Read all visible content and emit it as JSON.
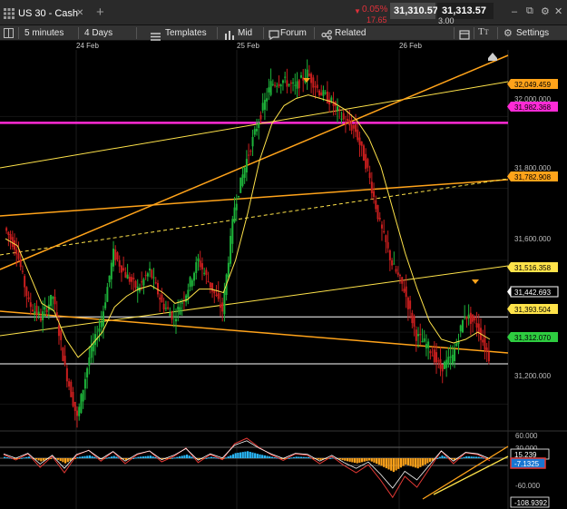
{
  "tab": {
    "title": "US 30 - Cash",
    "close": "✕",
    "add": "+"
  },
  "quote": {
    "change_pct": "0.05%",
    "change_pts": "17.65",
    "bid": "31,310.57",
    "ask": "31,313.57",
    "spread": "3.00",
    "colors": {
      "down": "#e0303a",
      "bid_bg": "#4a4a4a",
      "ask_bg": "#1e1e1e"
    }
  },
  "window": {
    "minimize": "–",
    "restore": "⧉",
    "settings": "⚙",
    "close": "✕"
  },
  "toolbar": {
    "interval": "5 minutes",
    "range": "4 Days",
    "templates": "Templates",
    "mid": "Mid",
    "forum": "Forum",
    "related": "Related",
    "settings": "Settings"
  },
  "dates": [
    "24 Feb",
    "25 Feb",
    "26 Feb"
  ],
  "colors": {
    "magenta": "#ff2bd6",
    "yellow": "#ffe34a",
    "orange": "#ffa31a",
    "white": "#ffffff",
    "cyan": "#29b6f6",
    "red": "#e53935"
  },
  "price_axis": {
    "ticks": [
      "32,000.000",
      "31,800.000",
      "31,600.000",
      "31,200.000"
    ],
    "labels": [
      {
        "text": "32,049.459",
        "style": "orange"
      },
      {
        "text": "31,982.368",
        "style": "magenta"
      },
      {
        "text": "31,782.908",
        "style": "orange"
      },
      {
        "text": "31,516.358",
        "style": "yellow"
      },
      {
        "text": "31,442.693",
        "style": "white"
      },
      {
        "text": "31,393.504",
        "style": "yellow"
      },
      {
        "text": "31,312.070",
        "style": "green"
      }
    ]
  },
  "osc_axis": {
    "ticks": [
      "60.000",
      "30.000",
      "-60.000"
    ],
    "labels": [
      {
        "text": "15.239",
        "style": "white"
      },
      {
        "text": "-7.1325",
        "style": "cyan"
      },
      {
        "text": "-108.9392",
        "style": "white"
      }
    ]
  },
  "chart_data": {
    "type": "line",
    "title": "US 30 - Cash",
    "interval": "5 minutes",
    "range": "4 Days",
    "ylim": [
      31100,
      32180
    ],
    "x": [
      "24 Feb",
      "25 Feb",
      "26 Feb"
    ],
    "series": [
      {
        "values": [
          31690,
          31630,
          31480,
          31440,
          31500,
          31300,
          31160,
          31330,
          31430,
          31620,
          31560,
          31520,
          31570,
          31480,
          31440,
          31510,
          31600,
          31530,
          31460,
          31750,
          31880,
          31990,
          32090,
          32100,
          32080,
          32120,
          32070,
          32040,
          31990,
          31960,
          31850,
          31700,
          31590,
          31520,
          31390,
          31360,
          31300,
          31330,
          31450,
          31420,
          31330
        ]
      },
      {
        "values": [
          31660,
          31640,
          31560,
          31480,
          31460,
          31380,
          31330,
          31360,
          31400,
          31470,
          31500,
          31520,
          31530,
          31510,
          31480,
          31490,
          31520,
          31520,
          31510,
          31600,
          31730,
          31880,
          31980,
          32030,
          32050,
          32060,
          32050,
          32040,
          32020,
          31990,
          31940,
          31860,
          31740,
          31620,
          31520,
          31430,
          31380,
          31370,
          31380,
          31400,
          31380
        ]
      }
    ],
    "oscillator": {
      "ylim": [
        -120,
        70
      ],
      "values": [
        10,
        -5,
        12,
        -25,
        5,
        -40,
        8,
        22,
        -8,
        18,
        -15,
        10,
        20,
        -10,
        5,
        28,
        -12,
        10,
        -4,
        40,
        55,
        30,
        10,
        -6,
        12,
        8,
        -15,
        5,
        -20,
        -40,
        -18,
        -60,
        -108,
        -50,
        -80,
        -30,
        20,
        -15,
        15,
        10,
        -7
      ]
    },
    "horizontal_lines": [
      31982.368,
      31442.693,
      31312.07
    ],
    "trendlines": [
      31782.908,
      32049.459,
      31516.358,
      31393.504
    ]
  }
}
